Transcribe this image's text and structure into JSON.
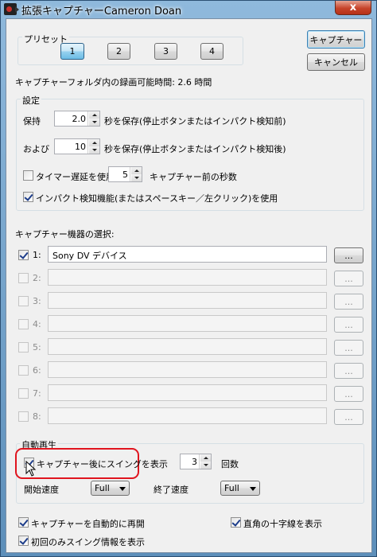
{
  "window": {
    "title": "拡張キャプチャーCameron Doan",
    "close_label": "x"
  },
  "preset": {
    "label": "プリセット",
    "buttons": [
      "1",
      "2",
      "3",
      "4"
    ],
    "selected": "1"
  },
  "actions": {
    "capture_label": "キャプチャー",
    "cancel_label": "キャンセル"
  },
  "recording_time": "キャプチャーフォルダ内の録画可能時間: 2.6 時間",
  "settings": {
    "label": "設定",
    "keep_label": "保持",
    "keep_value": "2.0",
    "keep_desc": "秒を保存(停止ボタンまたはインパクト検知前)",
    "and_label": "および",
    "and_value": "10",
    "and_desc": "秒を保存(停止ボタンまたはインパクト検知後)",
    "timer_label": "タイマー遅延を使用",
    "timer_value": "5",
    "timer_desc": "キャプチャー前の秒数",
    "impact_label": "インパクト検知機能(またはスペースキー／左クリック)を使用"
  },
  "devices": {
    "label": "キャプチャー機器の選択:",
    "browse_label": "...",
    "items": [
      {
        "num": "1:",
        "name": "Sony DV デバイス",
        "checked": true,
        "enabled": true
      },
      {
        "num": "2:",
        "name": "",
        "checked": false,
        "enabled": false
      },
      {
        "num": "3:",
        "name": "",
        "checked": false,
        "enabled": false
      },
      {
        "num": "4:",
        "name": "",
        "checked": false,
        "enabled": false
      },
      {
        "num": "5:",
        "name": "",
        "checked": false,
        "enabled": false
      },
      {
        "num": "6:",
        "name": "",
        "checked": false,
        "enabled": false
      },
      {
        "num": "7:",
        "name": "",
        "checked": false,
        "enabled": false
      },
      {
        "num": "8:",
        "name": "",
        "checked": false,
        "enabled": false
      }
    ]
  },
  "autoplay": {
    "label": "自動再生",
    "show_swing_label": "キャプチャー後にスイングを表示",
    "count_value": "3",
    "count_label": "回数",
    "start_speed_label": "開始速度",
    "start_speed_value": "Full",
    "end_speed_label": "終了速度",
    "end_speed_value": "Full"
  },
  "footer": {
    "auto_restart_label": "キャプチャーを自動的に再開",
    "crosshair_label": "直角の十字線を表示",
    "first_swing_info_label": "初回のみスイング情報を表示"
  }
}
